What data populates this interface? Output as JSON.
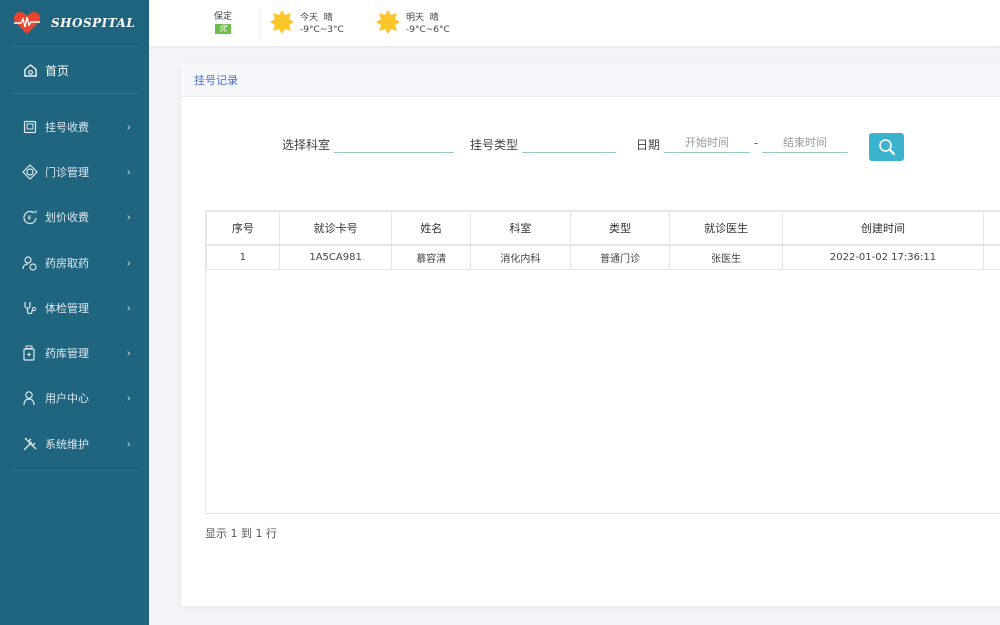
{
  "app": {
    "brand": "SHOSPITAL",
    "brand_color": "#1f6580",
    "accent_color": "#3bb3cf"
  },
  "sidebar": {
    "home": {
      "label": "首页",
      "icon": "home-icon"
    },
    "items": [
      {
        "label": "挂号收费",
        "icon": "register-card-icon"
      },
      {
        "label": "门诊管理",
        "icon": "outpatient-icon"
      },
      {
        "label": "划价收费",
        "icon": "pricing-yen-icon"
      },
      {
        "label": "药房取药",
        "icon": "pharmacy-user-icon"
      },
      {
        "label": "体检管理",
        "icon": "stethoscope-icon"
      },
      {
        "label": "药库管理",
        "icon": "medicine-bottle-icon"
      },
      {
        "label": "用户中心",
        "icon": "user-icon"
      },
      {
        "label": "系统维护",
        "icon": "tools-icon"
      }
    ]
  },
  "topbar": {
    "city": "保定",
    "aqi": "优",
    "today": {
      "label": "今天",
      "condition": "晴",
      "temp": "-9°C~3°C",
      "icon": "sun-icon"
    },
    "tomorrow": {
      "label": "明天",
      "condition": "晴",
      "temp": "-9°C~6°C",
      "icon": "sun-icon"
    }
  },
  "page": {
    "title": "挂号记录",
    "filter": {
      "department_label": "选择科室",
      "department_value": "",
      "type_label": "挂号类型",
      "type_value": "",
      "date_label": "日期",
      "start_placeholder": "开始时间",
      "separator": "-",
      "end_placeholder": "结束时间"
    },
    "table": {
      "columns": [
        "序号",
        "就诊卡号",
        "姓名",
        "科室",
        "类型",
        "就诊医生",
        "创建时间"
      ],
      "rows": [
        [
          "1",
          "1A5CA981",
          "慕容清",
          "消化内科",
          "普通门诊",
          "张医生",
          "2022-01-02 17:36:11"
        ]
      ]
    },
    "footer": "显示 1 到 1 行"
  }
}
